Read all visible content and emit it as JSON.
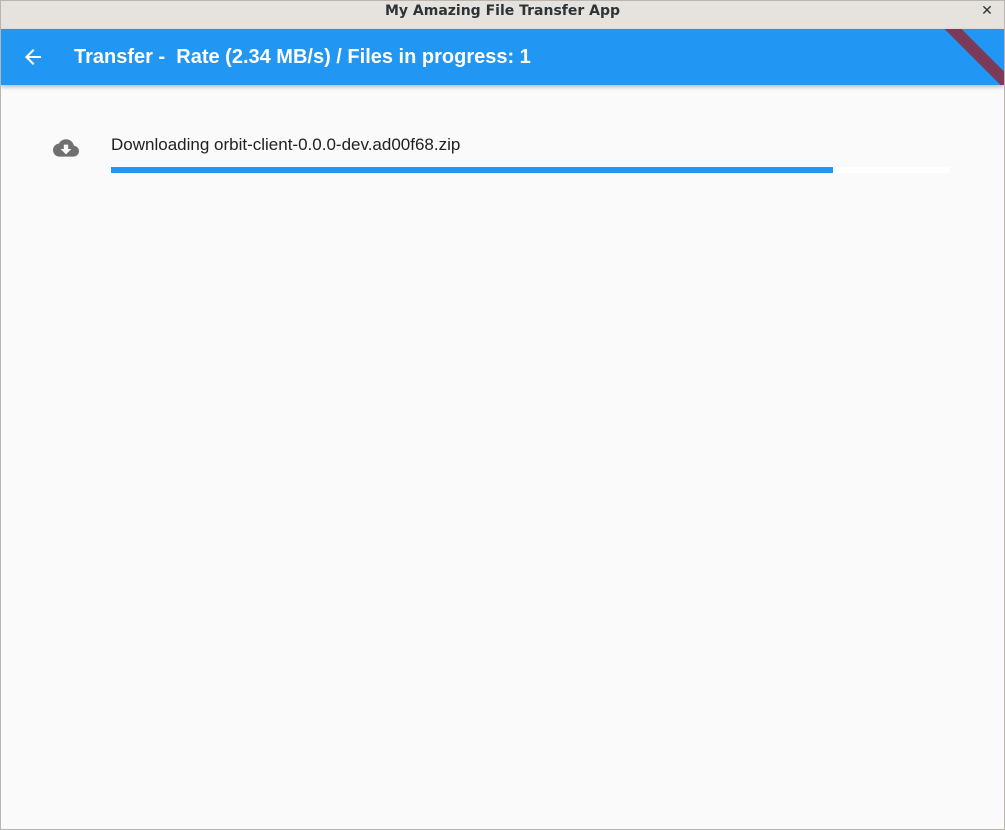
{
  "window": {
    "title": "My Amazing File Transfer App",
    "close_label": "✕"
  },
  "appbar": {
    "title": "Transfer -  Rate (2.34 MB/s) / Files in progress: 1",
    "back_icon": "arrow-back-icon",
    "color": "#2196f3"
  },
  "transfers": [
    {
      "icon": "cloud-download-icon",
      "label": "Downloading orbit-client-0.0.0-dev.ad00f68.zip",
      "progress": 0.86
    }
  ],
  "colors": {
    "accent": "#2196f3",
    "debug_banner": "#8b2a3b",
    "background": "#fafafa"
  }
}
